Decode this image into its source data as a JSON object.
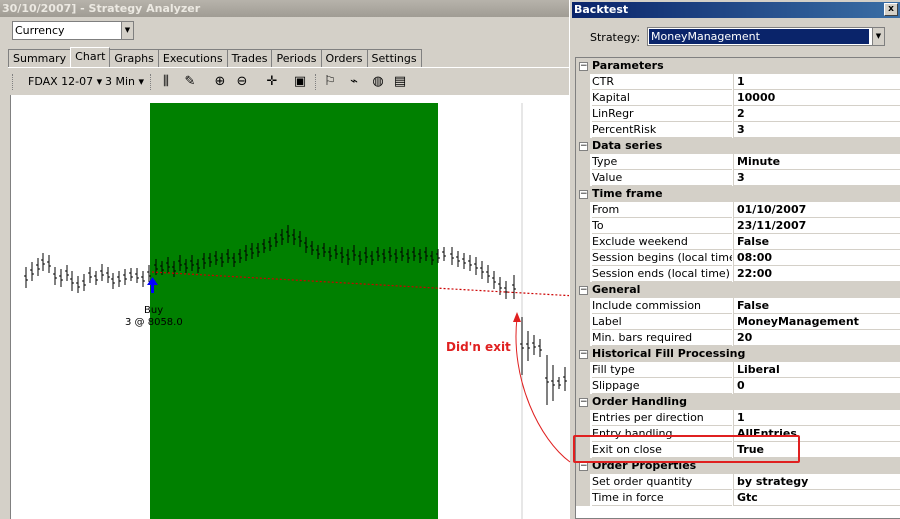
{
  "window_title": "30/10/2007] - Strategy Analyzer",
  "currency": {
    "value": "Currency"
  },
  "tabs": [
    "Summary",
    "Chart",
    "Graphs",
    "Executions",
    "Trades",
    "Periods",
    "Orders",
    "Settings"
  ],
  "active_tab": "Chart",
  "toolbar": {
    "instrument": "FDAX 12-07",
    "interval": "3 Min"
  },
  "chart": {
    "buy_label": "Buy",
    "buy_detail": "3 @ 8058.0",
    "annotation": "Did'n exit",
    "colors": {
      "session_fill": "#008000",
      "exit_line": "#cc0000",
      "bars": "#000000",
      "entry_arrow": "#0000ff",
      "annotation": "#e02020"
    }
  },
  "backtest": {
    "title": "Backtest",
    "close_glyph": "x",
    "strategy_label": "Strategy:",
    "strategy_value": "MoneyManagement",
    "categories": [
      {
        "name": "Parameters",
        "props": [
          {
            "name": "CTR",
            "value": "1"
          },
          {
            "name": "Kapital",
            "value": "10000"
          },
          {
            "name": "LinRegr",
            "value": "2"
          },
          {
            "name": "PercentRisk",
            "value": "3"
          }
        ]
      },
      {
        "name": "Data series",
        "props": [
          {
            "name": "Type",
            "value": "Minute"
          },
          {
            "name": "Value",
            "value": "3"
          }
        ]
      },
      {
        "name": "Time frame",
        "props": [
          {
            "name": "From",
            "value": "01/10/2007"
          },
          {
            "name": "To",
            "value": "23/11/2007"
          },
          {
            "name": "Exclude weekend",
            "value": "False"
          },
          {
            "name": "Session begins (local time)",
            "value": "08:00"
          },
          {
            "name": "Session ends (local time)",
            "value": "22:00"
          }
        ]
      },
      {
        "name": "General",
        "props": [
          {
            "name": "Include commission",
            "value": "False"
          },
          {
            "name": "Label",
            "value": "MoneyManagement"
          },
          {
            "name": "Min. bars required",
            "value": "20"
          }
        ]
      },
      {
        "name": "Historical Fill Processing",
        "props": [
          {
            "name": "Fill type",
            "value": "Liberal"
          },
          {
            "name": "Slippage",
            "value": "0"
          }
        ]
      },
      {
        "name": "Order Handling",
        "props": [
          {
            "name": "Entries per direction",
            "value": "1"
          },
          {
            "name": "Entry handling",
            "value": "AllEntries"
          },
          {
            "name": "Exit on close",
            "value": "True"
          }
        ]
      },
      {
        "name": "Order Properties",
        "props": [
          {
            "name": "Set order quantity",
            "value": "by strategy"
          },
          {
            "name": "Time in force",
            "value": "Gtc"
          }
        ]
      }
    ]
  }
}
